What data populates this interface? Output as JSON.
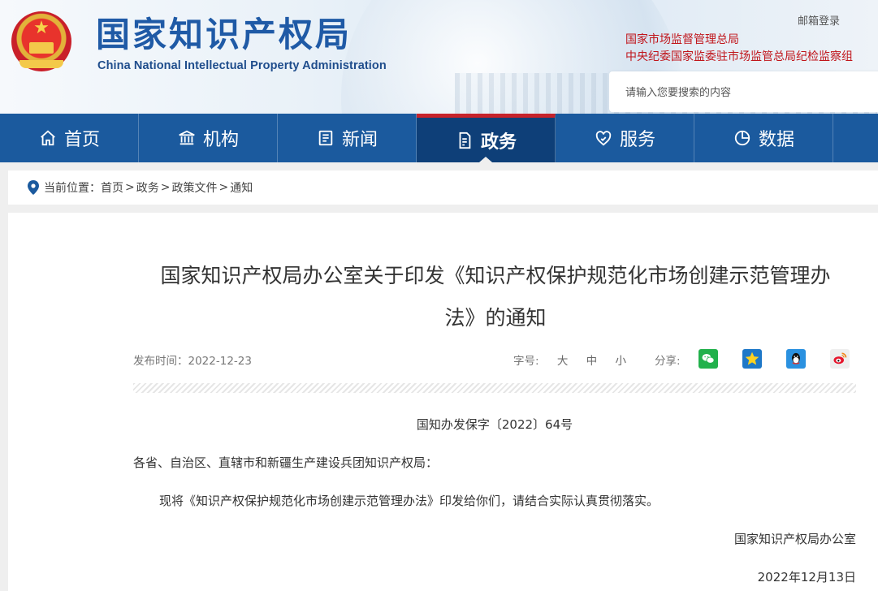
{
  "header": {
    "title_cn": "国家知识产权局",
    "title_en": "China National Intellectual Property Administration",
    "mail_login": "邮箱登录",
    "agency_1": "国家市场监督管理总局",
    "agency_2": "中央纪委国家监委驻市场监管总局纪检监察组",
    "search_placeholder": "请输入您要搜索的内容"
  },
  "nav": {
    "items": [
      {
        "label": "首页",
        "icon": "home-icon"
      },
      {
        "label": "机构",
        "icon": "institution-icon"
      },
      {
        "label": "新闻",
        "icon": "news-icon"
      },
      {
        "label": "政务",
        "icon": "document-icon",
        "active": true
      },
      {
        "label": "服务",
        "icon": "service-icon"
      },
      {
        "label": "数据",
        "icon": "pie-chart-icon"
      }
    ],
    "active_color": "#0e3f78",
    "bar_color": "#1b5a9e",
    "accent": "#c7232b"
  },
  "breadcrumb": {
    "prefix": "当前位置：",
    "items": [
      "首页",
      "政务",
      "政策文件",
      "通知"
    ],
    "separator": ">"
  },
  "article": {
    "title_line1": "国家知识产权局办公室关于印发《知识产权保护规范化市场创建示范管理办",
    "title_line2": "法》的通知",
    "publish_label": "发布时间：",
    "publish_date": "2022-12-23",
    "font_size_label": "字号:",
    "font_sizes": [
      "大",
      "中",
      "小"
    ],
    "share_label": "分享:",
    "share_icons": [
      "wechat-icon",
      "qzone-icon",
      "qq-icon",
      "weibo-icon"
    ],
    "doc_number": "国知办发保字〔2022〕64号",
    "salutation": "各省、自治区、直辖市和新疆生产建设兵团知识产权局：",
    "body": "现将《知识产权保护规范化市场创建示范管理办法》印发给你们，请结合实际认真贯彻落实。",
    "signature": "国家知识产权局办公室",
    "sign_date": "2022年12月13日"
  }
}
